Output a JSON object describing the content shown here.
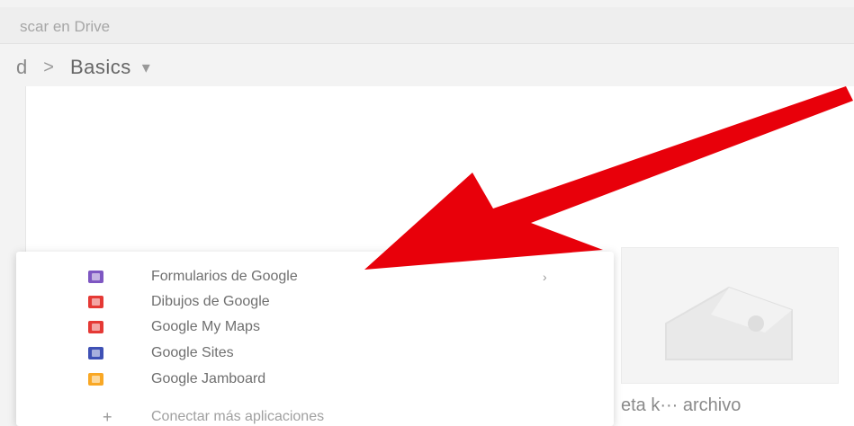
{
  "search": {
    "placeholder": "scar en Drive"
  },
  "breadcrumb": {
    "previous": "d",
    "separator": ">",
    "current": "Basics",
    "caret": "▾"
  },
  "menu": {
    "items": [
      {
        "label": "Formularios de Google",
        "icon": "google-forms-icon",
        "color": "#7e57c2",
        "has_submenu": true,
        "submenu_glyph": "›"
      },
      {
        "label": "Dibujos de Google",
        "icon": "google-drawings-icon",
        "color": "#e53935"
      },
      {
        "label": "Google My Maps",
        "icon": "google-my-maps-icon",
        "color": "#e53935"
      },
      {
        "label": "Google Sites",
        "icon": "google-sites-icon",
        "color": "#3f51b5"
      },
      {
        "label": "Google Jamboard",
        "icon": "google-jamboard-icon",
        "color": "#f9a825"
      }
    ],
    "connect": {
      "plus": "+",
      "label": "Conectar más aplicaciones"
    }
  },
  "tile": {
    "caption": "eta k··· archivo"
  },
  "colors": {
    "arrow": "#e8000a",
    "background": "#f3f3f3"
  }
}
